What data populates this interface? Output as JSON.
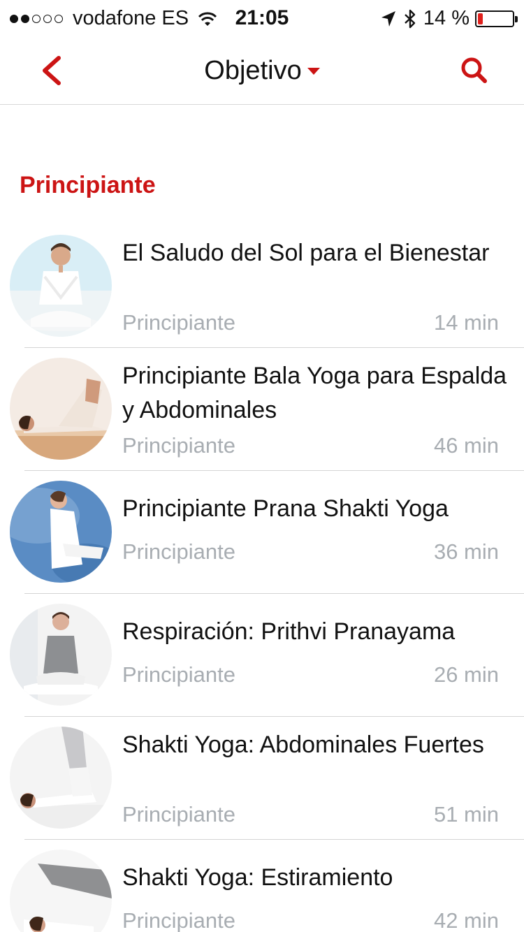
{
  "status_bar": {
    "carrier": "vodafone ES",
    "time": "21:05",
    "battery": "14 %",
    "battery_level": 0.14
  },
  "nav": {
    "title": "Objetivo"
  },
  "section": {
    "title": "Principiante"
  },
  "items": [
    {
      "title": "El Saludo del Sol para el Bienestar",
      "level": "Principiante",
      "duration": "14 min"
    },
    {
      "title": "Principiante Bala Yoga para Espalda y Abdominales",
      "level": "Principiante",
      "duration": "46 min"
    },
    {
      "title": "Principiante Prana Shakti Yoga",
      "level": "Principiante",
      "duration": "36 min"
    },
    {
      "title": "Respiración: Prithvi Pranayama",
      "level": "Principiante",
      "duration": "26 min"
    },
    {
      "title": "Shakti Yoga: Abdominales Fuertes",
      "level": "Principiante",
      "duration": "51 min"
    },
    {
      "title": "Shakti Yoga: Estiramiento",
      "level": "Principiante",
      "duration": "42 min"
    }
  ],
  "colors": {
    "accent": "#cc1414",
    "secondary_text": "#a8adb2"
  }
}
